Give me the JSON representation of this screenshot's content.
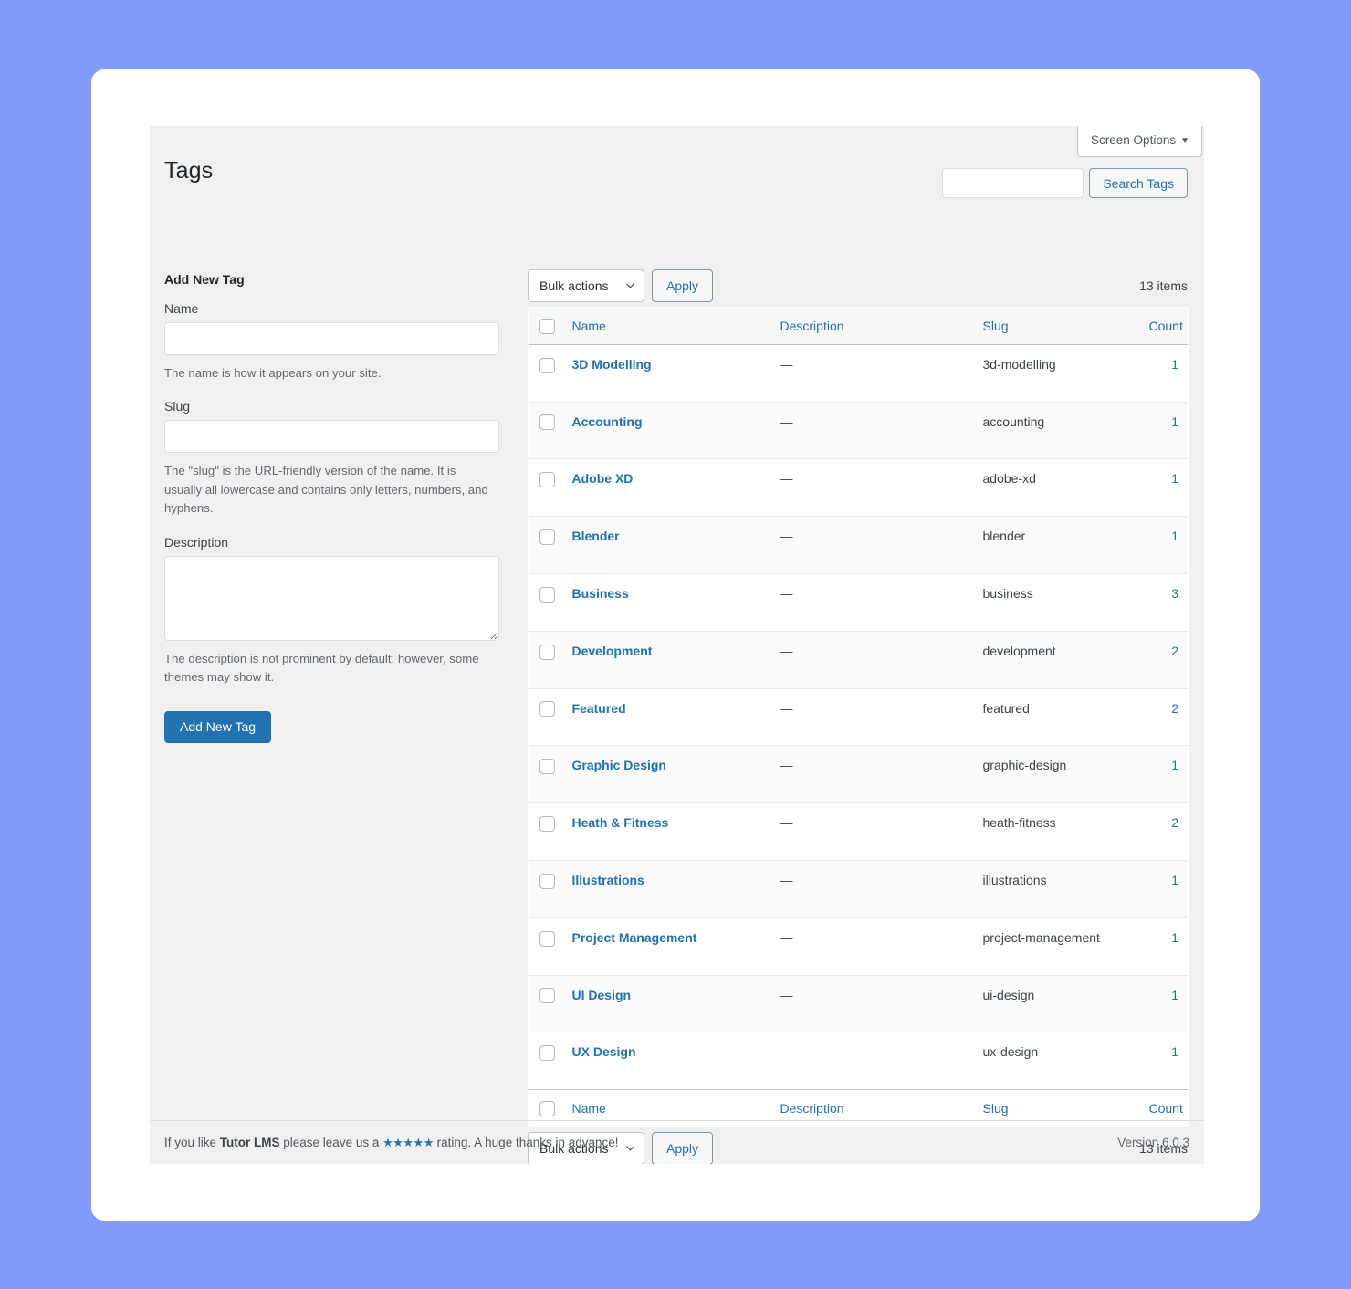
{
  "page": {
    "title": "Tags",
    "screen_options_label": "Screen Options",
    "screen_options_caret": "▼"
  },
  "search": {
    "value": "",
    "placeholder": "",
    "button_label": "Search Tags"
  },
  "form": {
    "heading": "Add New Tag",
    "name_label": "Name",
    "name_value": "",
    "name_help": "The name is how it appears on your site.",
    "slug_label": "Slug",
    "slug_value": "",
    "slug_help": "The \"slug\" is the URL-friendly version of the name. It is usually all lowercase and contains only letters, numbers, and hyphens.",
    "description_label": "Description",
    "description_value": "",
    "description_help": "The description is not prominent by default; however, some themes may show it.",
    "submit_label": "Add New Tag"
  },
  "tablenav_top": {
    "bulk_actions_label": "Bulk actions",
    "apply_label": "Apply",
    "items_count": "13 items"
  },
  "tablenav_bottom": {
    "bulk_actions_label": "Bulk actions",
    "apply_label": "Apply",
    "items_count": "13 items"
  },
  "table": {
    "columns": [
      "Name",
      "Description",
      "Slug",
      "Count"
    ],
    "rows": [
      {
        "name": "3D Modelling",
        "description": "—",
        "slug": "3d-modelling",
        "count": "1"
      },
      {
        "name": "Accounting",
        "description": "—",
        "slug": "accounting",
        "count": "1"
      },
      {
        "name": "Adobe XD",
        "description": "—",
        "slug": "adobe-xd",
        "count": "1"
      },
      {
        "name": "Blender",
        "description": "—",
        "slug": "blender",
        "count": "1"
      },
      {
        "name": "Business",
        "description": "—",
        "slug": "business",
        "count": "3"
      },
      {
        "name": "Development",
        "description": "—",
        "slug": "development",
        "count": "2"
      },
      {
        "name": "Featured",
        "description": "—",
        "slug": "featured",
        "count": "2"
      },
      {
        "name": "Graphic Design",
        "description": "—",
        "slug": "graphic-design",
        "count": "1"
      },
      {
        "name": "Heath & Fitness",
        "description": "—",
        "slug": "heath-fitness",
        "count": "2"
      },
      {
        "name": "Illustrations",
        "description": "—",
        "slug": "illustrations",
        "count": "1"
      },
      {
        "name": "Project Management",
        "description": "—",
        "slug": "project-management",
        "count": "1"
      },
      {
        "name": "UI Design",
        "description": "—",
        "slug": "ui-design",
        "count": "1"
      },
      {
        "name": "UX Design",
        "description": "—",
        "slug": "ux-design",
        "count": "1"
      }
    ]
  },
  "footer": {
    "text_before": "If you like ",
    "product": "Tutor LMS",
    "text_middle": " please leave us a ",
    "stars": "★★★★★",
    "text_after": " rating. A huge thanks in advance!",
    "version": "Version 6.0.3"
  },
  "colors": {
    "accent": "#2271b1",
    "page_background": "#819bfa",
    "panel_background": "#f0f0f1",
    "table_header_background": "#f6f7f7"
  }
}
